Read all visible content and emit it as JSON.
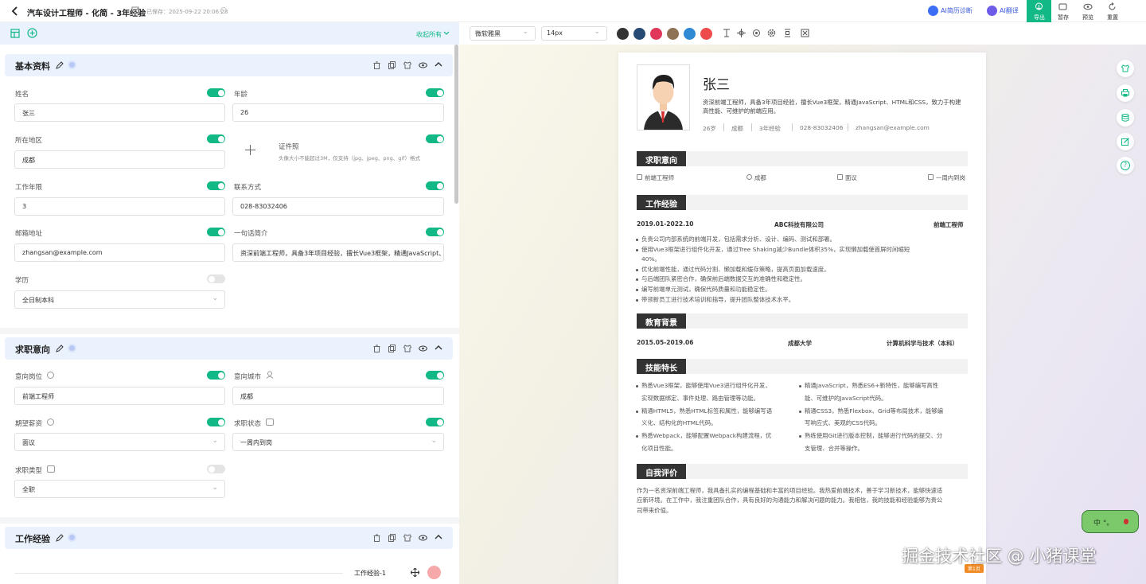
{
  "header": {
    "title": "汽车设计工程师 - 化简 - 3年经验",
    "saved": "已保存：2025-09-22 20:06:28",
    "ai_diag": "AI简历诊断",
    "ai_trans": "AI翻译",
    "actions": [
      {
        "label": "导出",
        "icon": "export-icon"
      },
      {
        "label": "暂存",
        "icon": "save-icon"
      },
      {
        "label": "预览",
        "icon": "eye-icon"
      },
      {
        "label": "重置",
        "icon": "reset-icon"
      }
    ]
  },
  "editor": {
    "collapse_all": "收起所有",
    "basic": {
      "title": "基本资料",
      "name_label": "姓名",
      "name_value": "张三",
      "age_label": "年龄",
      "age_value": "26",
      "region_label": "所在地区",
      "region_value": "成都",
      "photo_label": "证件照",
      "photo_hint": "头像大小不能超过3M，仅支持（jpg、jpeg、png、gif）格式",
      "years_label": "工作年限",
      "years_value": "3",
      "contact_label": "联系方式",
      "contact_value": "028-83032406",
      "email_label": "邮箱地址",
      "email_value": "zhangsan@example.com",
      "intro_label": "一句话简介",
      "intro_value": "资深前端工程师，具备3年项目经验，擅长Vue3框架，精通JavaScript、HTML和CSS，致力于构建高性能、可维护的前端应用。",
      "edu_label": "学历",
      "edu_value": "全日制本科"
    },
    "intent": {
      "title": "求职意向",
      "pos_label": "意向岗位",
      "pos_value": "前端工程师",
      "city_label": "意向城市",
      "city_value": "成都",
      "salary_label": "期望薪资",
      "salary_value": "面议",
      "status_label": "求职状态",
      "status_value": "一周内到岗",
      "type_label": "求职类型",
      "type_value": "全职"
    },
    "work": {
      "title": "工作经验",
      "item_label": "工作经验-1"
    }
  },
  "toolbar": {
    "font": "微软雅黑",
    "size": "14px",
    "colors": [
      "#333333",
      "#264a73",
      "#e0375a",
      "#8e7357",
      "#2f89d3",
      "#ee4c4c"
    ]
  },
  "resume": {
    "name": "张三",
    "summary": "资深前端工程师，具备3年项目经验，擅长Vue3框架，精通JavaScript、HTML和CSS，致力于构建高性能、可维护的前端应用。",
    "meta": [
      "26岁",
      "成都",
      "3年经验",
      "028-83032406",
      "zhangsan@example.com"
    ],
    "intent_title": "求职意向",
    "intent": [
      "前端工程师",
      "成都",
      "面议",
      "一周内到岗"
    ],
    "work_title": "工作经验",
    "work": {
      "period": "2019.01-2022.10",
      "company": "ABC科技有限公司",
      "role": "前端工程师",
      "bullets": [
        "负责公司内部系统的前端开发，包括需求分析、设计、编码、测试和部署。",
        "使用Vue3框架进行组件化开发，通过Tree Shaking减少Bundle体积35%，实现懒加载使首屏时间缩短",
        "40%。",
        "优化前端性能，通过代码分割、懒加载和缓存策略，提高页面加载速度。",
        "与后端团队紧密合作，确保前后端数据交互的准确性和稳定性。",
        "编写前端单元测试，确保代码质量和功能稳定性。",
        "带领新员工进行技术培训和指导，提升团队整体技术水平。"
      ]
    },
    "edu_title": "教育背景",
    "edu": {
      "period": "2015.05-2019.06",
      "school": "成都大学",
      "major": "计算机科学与技术（本科）"
    },
    "skills_title": "技能特长",
    "skills_left": [
      "熟悉Vue3框架，能够使用Vue3进行组件化开发，",
      "实现数据绑定、事件处理、路由管理等功能。",
      "精通HTML5，熟悉HTML标签和属性，能够编写语",
      "义化、结构化的HTML代码。",
      "熟悉Webpack，能够配置Webpack构建流程，优",
      "化项目性能。"
    ],
    "skills_right": [
      "精通JavaScript，熟悉ES6+新特性，能够编写高性",
      "能、可维护的JavaScript代码。",
      "精通CSS3，熟悉Flexbox、Grid等布局技术，能够编",
      "写响应式、美观的CSS代码。",
      "熟练使用Git进行版本控制，能够进行代码的提交、分",
      "支管理、合并等操作。"
    ],
    "self_title": "自我评价",
    "self": [
      "作为一名资深前端工程师，我具备扎实的编程基础和丰富的项目经验。我热爱前端技术，善于学习新技术，能够快速适",
      "应新环境。在工作中，我注重团队合作，具有良好的沟通能力和解决问题的能力。我相信，我的技能和经验能够为贵公",
      "司带来价值。"
    ],
    "page_tag": "第1页"
  },
  "watermark": "掘金技术社区 @ 小猪课堂",
  "mascot": "中 °。"
}
